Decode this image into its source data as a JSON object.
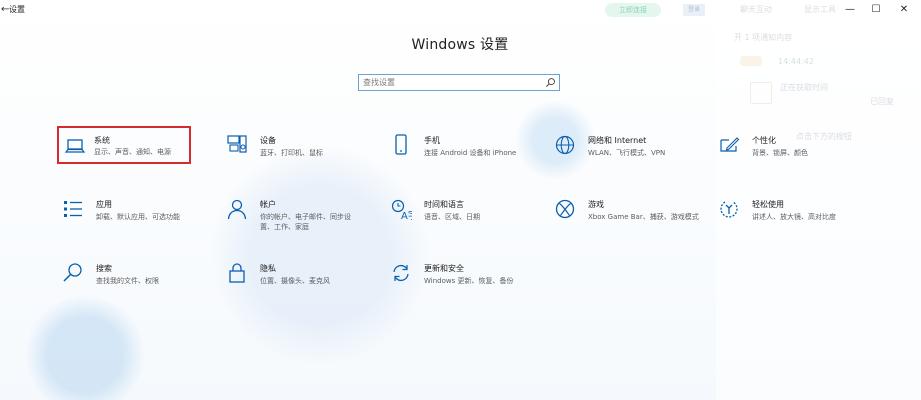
{
  "window": {
    "back_glyph": "←",
    "title": "设置",
    "controls": {
      "minimize": "—",
      "maximize": "☐",
      "close": "✕"
    }
  },
  "header": {
    "title": "Windows 设置"
  },
  "search": {
    "placeholder": "查找设置",
    "value": ""
  },
  "tiles": [
    {
      "key": "system",
      "title": "系统",
      "desc": "显示、声音、通知、电源",
      "icon": "laptop-icon",
      "selected": true
    },
    {
      "key": "devices",
      "title": "设备",
      "desc": "蓝牙、打印机、鼠标",
      "icon": "keyboard-speaker-icon"
    },
    {
      "key": "phone",
      "title": "手机",
      "desc": "连接 Android 设备和 iPhone",
      "icon": "phone-icon"
    },
    {
      "key": "network",
      "title": "网络和 Internet",
      "desc": "WLAN、飞行模式、VPN",
      "icon": "globe-icon"
    },
    {
      "key": "personalization",
      "title": "个性化",
      "desc": "背景、锁屏、颜色",
      "icon": "pen-screen-icon"
    },
    {
      "key": "apps",
      "title": "应用",
      "desc": "卸载、默认应用、可选功能",
      "icon": "apps-list-icon"
    },
    {
      "key": "accounts",
      "title": "帐户",
      "desc": "你的帐户、电子邮件、同步设置、工作、家庭",
      "icon": "person-icon"
    },
    {
      "key": "time",
      "title": "时间和语言",
      "desc": "语音、区域、日期",
      "icon": "time-language-icon"
    },
    {
      "key": "gaming",
      "title": "游戏",
      "desc": "Xbox Game Bar、捕获、游戏模式",
      "icon": "xbox-icon"
    },
    {
      "key": "ease",
      "title": "轻松使用",
      "desc": "讲述人、放大镜、高对比度",
      "icon": "ease-of-access-icon"
    },
    {
      "key": "search",
      "title": "搜索",
      "desc": "查找我的文件、权限",
      "icon": "magnifier-icon"
    },
    {
      "key": "privacy",
      "title": "隐私",
      "desc": "位置、摄像头、麦克风",
      "icon": "lock-icon"
    },
    {
      "key": "update",
      "title": "更新和安全",
      "desc": "Windows 更新、恢复、备份",
      "icon": "sync-icon"
    }
  ],
  "overlay": {
    "pill": "立即连接",
    "btn": "登录",
    "top_link_1": "聊天互动",
    "top_link_2": "显示工具",
    "line1": "开 1 项通知内容",
    "time": "14:44:42",
    "ago": "已回复",
    "note": "正在获取时间",
    "hint": "点击下方的按钮"
  },
  "colors": {
    "accent": "#0067c0",
    "selected_border": "#d72a2a",
    "search_border": "#6fa2d4"
  }
}
